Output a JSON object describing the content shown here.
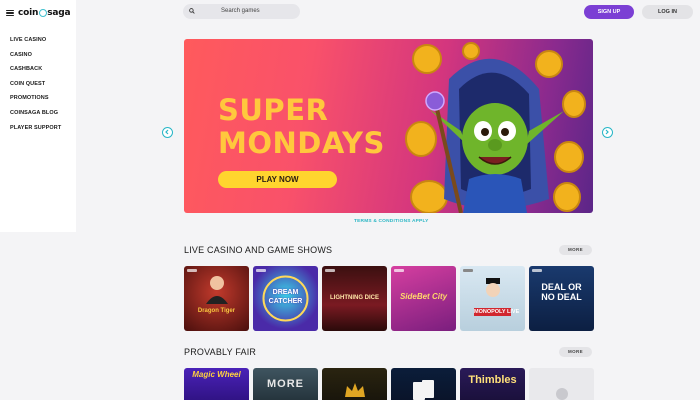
{
  "header": {
    "logo": {
      "left": "coin",
      "right": "saga"
    },
    "search_placeholder": "Search games",
    "signup_label": "SIGN UP",
    "login_label": "LOG IN"
  },
  "sidebar": {
    "items": [
      {
        "label": "LIVE CASINO"
      },
      {
        "label": "CASINO"
      },
      {
        "label": "CASHBACK"
      },
      {
        "label": "COIN QUEST"
      },
      {
        "label": "PROMOTIONS"
      },
      {
        "label": "COINSAGA BLOG"
      },
      {
        "label": "PLAYER SUPPORT"
      }
    ]
  },
  "banner": {
    "title_line1": "SUPER",
    "title_line2": "MONDAYS",
    "cta": "PLAY NOW",
    "terms": "TERMS & CONDITIONS APPLY"
  },
  "sections": [
    {
      "title": "LIVE CASINO AND GAME SHOWS",
      "more": "MORE",
      "tiles": [
        {
          "label": "Dragon Tiger",
          "name": "dragon-tiger"
        },
        {
          "label": "DREAM CATCHER",
          "name": "dream-catcher"
        },
        {
          "label": "LIGHTNING DICE",
          "name": "lightning-dice"
        },
        {
          "label": "SideBet City",
          "name": "side-bet-city"
        },
        {
          "label": "MONOPOLY LIVE",
          "name": "monopoly-live"
        },
        {
          "label": "DEAL OR NO DEAL",
          "name": "deal-or-no-deal"
        }
      ]
    },
    {
      "title": "PROVABLY FAIR",
      "more": "MORE",
      "tiles": [
        {
          "label": "Magic Wheel",
          "name": "magic-wheel"
        },
        {
          "label": "MORE",
          "name": "more-less"
        },
        {
          "label": "",
          "name": "crown-game"
        },
        {
          "label": "",
          "name": "cards-game"
        },
        {
          "label": "Thimbles",
          "name": "thimbles"
        },
        {
          "label": "",
          "name": "loading-tile"
        }
      ]
    }
  ],
  "colors": {
    "accent_purple": "#7b3fd4",
    "teal": "#27b6c7",
    "banner_yellow": "#ffd52e"
  }
}
